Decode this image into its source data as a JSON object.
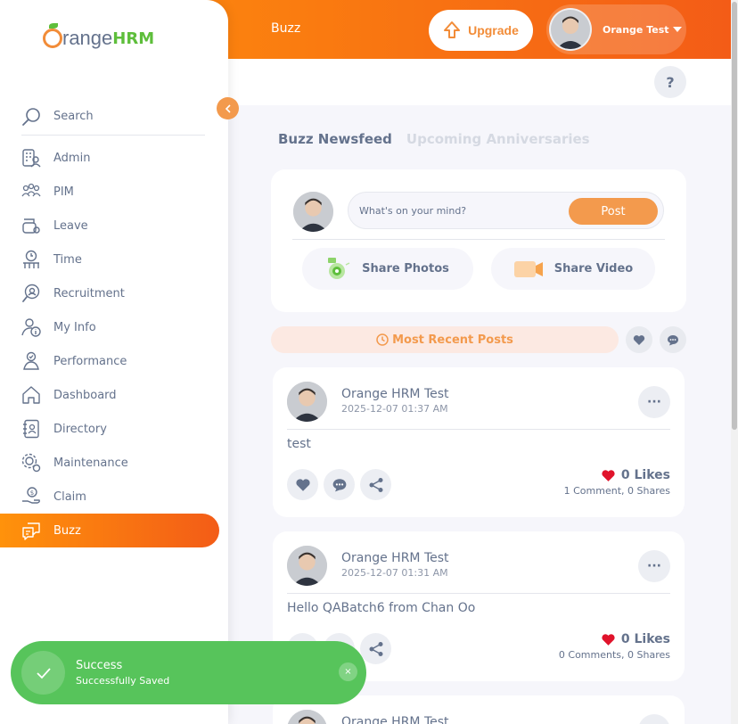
{
  "topbar": {
    "title": "Buzz",
    "upgrade_label": "Upgrade",
    "user_name": "Orange Test"
  },
  "help": {
    "label": "?"
  },
  "sidebar": {
    "logo_text": "range",
    "logo_hrm": "HRM",
    "search_placeholder": "Search",
    "items": [
      {
        "label": "Admin",
        "icon": "admin-icon"
      },
      {
        "label": "PIM",
        "icon": "pim-icon"
      },
      {
        "label": "Leave",
        "icon": "leave-icon"
      },
      {
        "label": "Time",
        "icon": "time-icon"
      },
      {
        "label": "Recruitment",
        "icon": "recruitment-icon"
      },
      {
        "label": "My Info",
        "icon": "my-info-icon"
      },
      {
        "label": "Performance",
        "icon": "performance-icon"
      },
      {
        "label": "Dashboard",
        "icon": "dashboard-icon"
      },
      {
        "label": "Directory",
        "icon": "directory-icon"
      },
      {
        "label": "Maintenance",
        "icon": "maintenance-icon"
      },
      {
        "label": "Claim",
        "icon": "claim-icon"
      },
      {
        "label": "Buzz",
        "icon": "buzz-icon",
        "active": true
      }
    ]
  },
  "tabs": {
    "newsfeed": "Buzz Newsfeed",
    "anniversaries": "Upcoming Anniversaries"
  },
  "composer": {
    "placeholder": "What's on your mind?",
    "post_label": "Post",
    "share_photos": "Share Photos",
    "share_video": "Share Video"
  },
  "feed": {
    "most_recent_label": "Most Recent Posts"
  },
  "posts": [
    {
      "author": "Orange HRM Test",
      "date": "2025-12-07 01:37 AM",
      "text": "test",
      "likes": "0 Likes",
      "comments": "1 Comment",
      "shares": "0 Shares"
    },
    {
      "author": "Orange HRM Test",
      "date": "2025-12-07 01:31 AM",
      "text": "Hello QABatch6 from Chan Oo",
      "likes": "0 Likes",
      "comments": "0 Comments",
      "shares": "0 Shares"
    },
    {
      "author": "Orange HRM Test"
    }
  ],
  "toast": {
    "title": "Success",
    "message": "Successfully Saved",
    "close": "×"
  },
  "colors": {
    "brand_orange": "#f35c17",
    "accent_orange": "#f39a4d",
    "success_green": "#57c45b",
    "heart_red": "#e0132b"
  }
}
